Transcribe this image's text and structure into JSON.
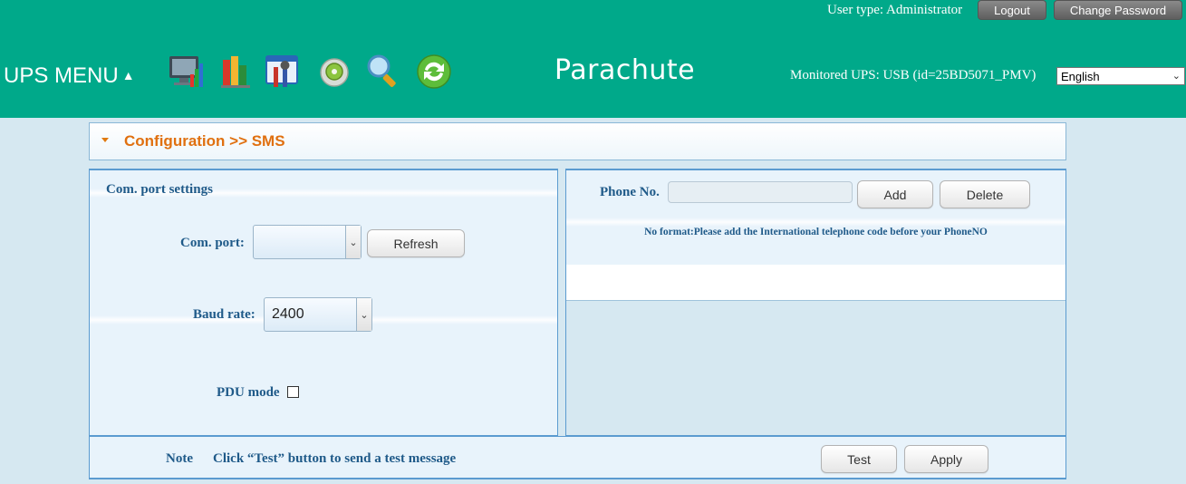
{
  "header": {
    "user_type": "User type: Administrator",
    "logout_label": "Logout",
    "change_password_label": "Change Password",
    "menu_label": "UPS MENU",
    "brand": "Parachute",
    "monitored_ups": "Monitored UPS: USB (id=25BD5071_PMV)",
    "language": "English",
    "toolbar_icons": [
      "monitor-chart-icon",
      "bar-chart-icon",
      "settings-tools-icon",
      "disc-icon",
      "magnifier-icon",
      "refresh-icon"
    ]
  },
  "page": {
    "title": "Configuration >> SMS"
  },
  "com_settings": {
    "heading": "Com. port settings",
    "com_port_label": "Com. port:",
    "com_port_value": "",
    "refresh_label": "Refresh",
    "baud_rate_label": "Baud rate:",
    "baud_rate_value": "2400",
    "pdu_mode_label": "PDU mode",
    "pdu_mode_checked": false
  },
  "phone": {
    "label": "Phone No.",
    "value": "",
    "add_label": "Add",
    "delete_label": "Delete",
    "format_note": "No format:Please add the International telephone code before your PhoneNO"
  },
  "footer": {
    "note_label": "Note",
    "note_text": "Click “Test” button to send a test message",
    "test_label": "Test",
    "apply_label": "Apply"
  },
  "colors": {
    "header_bg": "#00a98a",
    "title_orange": "#e07010",
    "label_blue": "#1f5a89",
    "page_bg": "#d6e8f1"
  }
}
